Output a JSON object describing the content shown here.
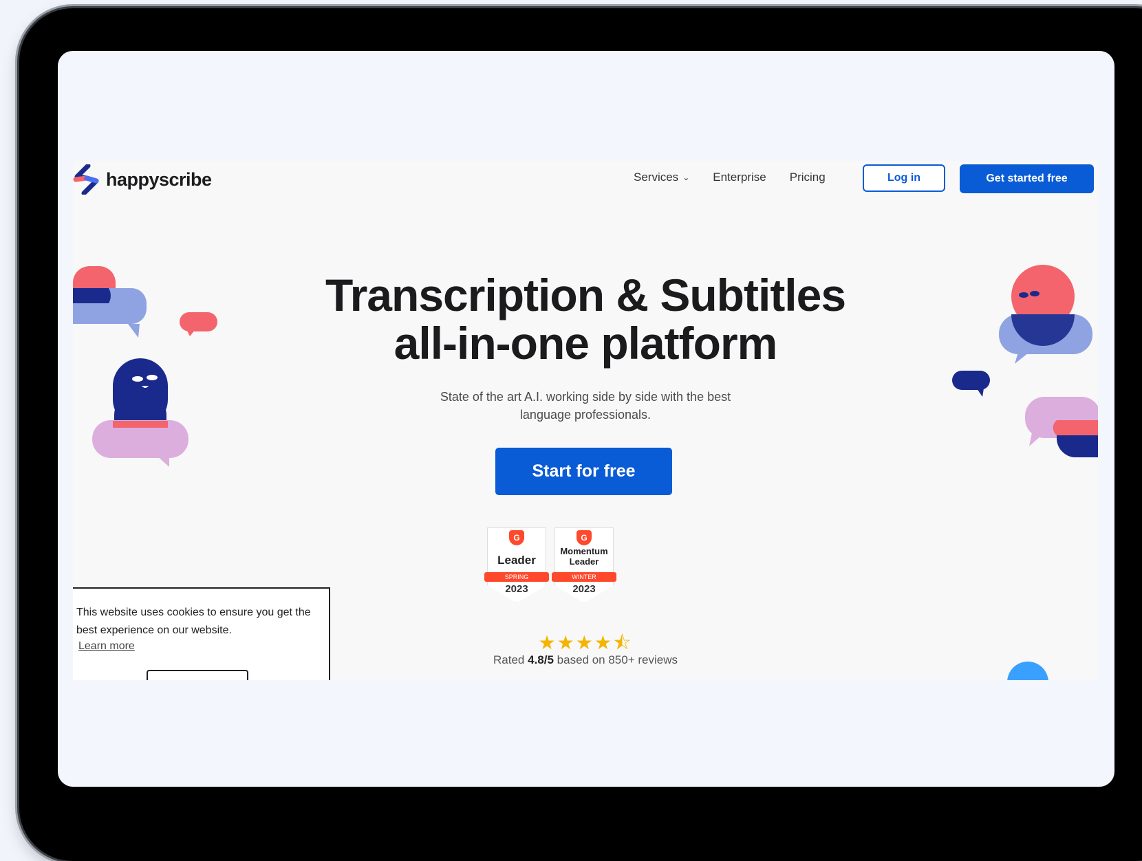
{
  "brand": {
    "name": "happyscribe",
    "colors": {
      "primary": "#0a5bd6",
      "logo_blue": "#1a2a8c",
      "logo_pink": "#f3646c",
      "star": "#f4b400",
      "g2_red": "#ff492c"
    }
  },
  "nav": {
    "links": [
      {
        "label": "Services",
        "icon": "chevron-down-icon"
      },
      {
        "label": "Enterprise"
      },
      {
        "label": "Pricing"
      }
    ],
    "login_label": "Log in",
    "cta_label": "Get started free"
  },
  "hero": {
    "title_line1": "Transcription & Subtitles",
    "title_line2": "all-in-one platform",
    "subtitle_line1": "State of the art A.I. working side by side with the best",
    "subtitle_line2": "language professionals.",
    "cta_label": "Start for free"
  },
  "badges": [
    {
      "title": "Leader",
      "season": "SPRING",
      "year": "2023"
    },
    {
      "title_line1": "Momentum",
      "title_line2": "Leader",
      "season": "WINTER",
      "year": "2023"
    }
  ],
  "rating": {
    "stars": "★★★★⯪",
    "prefix": "Rated",
    "score": "4.8/5",
    "suffix": "based on 850+ reviews"
  },
  "cookie": {
    "message": "This website uses cookies to ensure you get the best experience on our website.",
    "learn_more": "Learn more"
  }
}
